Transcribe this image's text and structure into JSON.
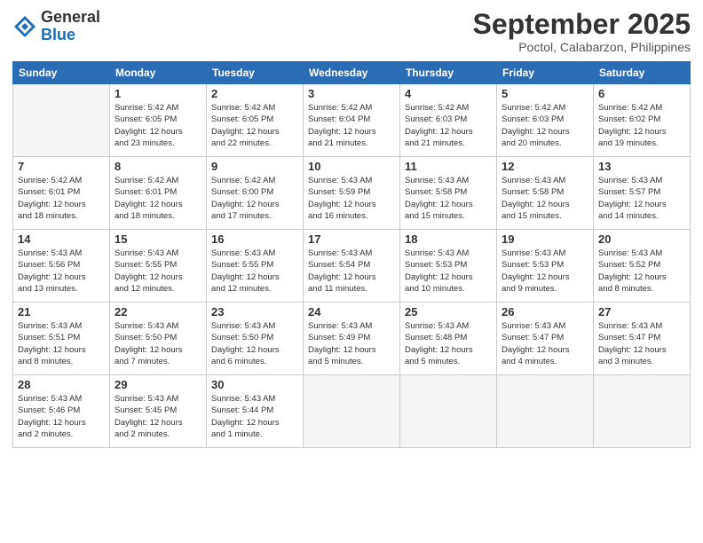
{
  "logo": {
    "general": "General",
    "blue": "Blue"
  },
  "header": {
    "month": "September 2025",
    "location": "Poctol, Calabarzon, Philippines"
  },
  "weekdays": [
    "Sunday",
    "Monday",
    "Tuesday",
    "Wednesday",
    "Thursday",
    "Friday",
    "Saturday"
  ],
  "weeks": [
    [
      {
        "day": "",
        "sunrise": "",
        "sunset": "",
        "daylight": ""
      },
      {
        "day": "1",
        "sunrise": "5:42 AM",
        "sunset": "6:05 PM",
        "dl1": "Daylight: 12 hours",
        "dl2": "and 23 minutes."
      },
      {
        "day": "2",
        "sunrise": "5:42 AM",
        "sunset": "6:05 PM",
        "dl1": "Daylight: 12 hours",
        "dl2": "and 22 minutes."
      },
      {
        "day": "3",
        "sunrise": "5:42 AM",
        "sunset": "6:04 PM",
        "dl1": "Daylight: 12 hours",
        "dl2": "and 21 minutes."
      },
      {
        "day": "4",
        "sunrise": "5:42 AM",
        "sunset": "6:03 PM",
        "dl1": "Daylight: 12 hours",
        "dl2": "and 21 minutes."
      },
      {
        "day": "5",
        "sunrise": "5:42 AM",
        "sunset": "6:03 PM",
        "dl1": "Daylight: 12 hours",
        "dl2": "and 20 minutes."
      },
      {
        "day": "6",
        "sunrise": "5:42 AM",
        "sunset": "6:02 PM",
        "dl1": "Daylight: 12 hours",
        "dl2": "and 19 minutes."
      }
    ],
    [
      {
        "day": "7",
        "sunrise": "5:42 AM",
        "sunset": "6:01 PM",
        "dl1": "Daylight: 12 hours",
        "dl2": "and 18 minutes."
      },
      {
        "day": "8",
        "sunrise": "5:42 AM",
        "sunset": "6:01 PM",
        "dl1": "Daylight: 12 hours",
        "dl2": "and 18 minutes."
      },
      {
        "day": "9",
        "sunrise": "5:42 AM",
        "sunset": "6:00 PM",
        "dl1": "Daylight: 12 hours",
        "dl2": "and 17 minutes."
      },
      {
        "day": "10",
        "sunrise": "5:43 AM",
        "sunset": "5:59 PM",
        "dl1": "Daylight: 12 hours",
        "dl2": "and 16 minutes."
      },
      {
        "day": "11",
        "sunrise": "5:43 AM",
        "sunset": "5:58 PM",
        "dl1": "Daylight: 12 hours",
        "dl2": "and 15 minutes."
      },
      {
        "day": "12",
        "sunrise": "5:43 AM",
        "sunset": "5:58 PM",
        "dl1": "Daylight: 12 hours",
        "dl2": "and 15 minutes."
      },
      {
        "day": "13",
        "sunrise": "5:43 AM",
        "sunset": "5:57 PM",
        "dl1": "Daylight: 12 hours",
        "dl2": "and 14 minutes."
      }
    ],
    [
      {
        "day": "14",
        "sunrise": "5:43 AM",
        "sunset": "5:56 PM",
        "dl1": "Daylight: 12 hours",
        "dl2": "and 13 minutes."
      },
      {
        "day": "15",
        "sunrise": "5:43 AM",
        "sunset": "5:55 PM",
        "dl1": "Daylight: 12 hours",
        "dl2": "and 12 minutes."
      },
      {
        "day": "16",
        "sunrise": "5:43 AM",
        "sunset": "5:55 PM",
        "dl1": "Daylight: 12 hours",
        "dl2": "and 12 minutes."
      },
      {
        "day": "17",
        "sunrise": "5:43 AM",
        "sunset": "5:54 PM",
        "dl1": "Daylight: 12 hours",
        "dl2": "and 11 minutes."
      },
      {
        "day": "18",
        "sunrise": "5:43 AM",
        "sunset": "5:53 PM",
        "dl1": "Daylight: 12 hours",
        "dl2": "and 10 minutes."
      },
      {
        "day": "19",
        "sunrise": "5:43 AM",
        "sunset": "5:53 PM",
        "dl1": "Daylight: 12 hours",
        "dl2": "and 9 minutes."
      },
      {
        "day": "20",
        "sunrise": "5:43 AM",
        "sunset": "5:52 PM",
        "dl1": "Daylight: 12 hours",
        "dl2": "and 8 minutes."
      }
    ],
    [
      {
        "day": "21",
        "sunrise": "5:43 AM",
        "sunset": "5:51 PM",
        "dl1": "Daylight: 12 hours",
        "dl2": "and 8 minutes."
      },
      {
        "day": "22",
        "sunrise": "5:43 AM",
        "sunset": "5:50 PM",
        "dl1": "Daylight: 12 hours",
        "dl2": "and 7 minutes."
      },
      {
        "day": "23",
        "sunrise": "5:43 AM",
        "sunset": "5:50 PM",
        "dl1": "Daylight: 12 hours",
        "dl2": "and 6 minutes."
      },
      {
        "day": "24",
        "sunrise": "5:43 AM",
        "sunset": "5:49 PM",
        "dl1": "Daylight: 12 hours",
        "dl2": "and 5 minutes."
      },
      {
        "day": "25",
        "sunrise": "5:43 AM",
        "sunset": "5:48 PM",
        "dl1": "Daylight: 12 hours",
        "dl2": "and 5 minutes."
      },
      {
        "day": "26",
        "sunrise": "5:43 AM",
        "sunset": "5:47 PM",
        "dl1": "Daylight: 12 hours",
        "dl2": "and 4 minutes."
      },
      {
        "day": "27",
        "sunrise": "5:43 AM",
        "sunset": "5:47 PM",
        "dl1": "Daylight: 12 hours",
        "dl2": "and 3 minutes."
      }
    ],
    [
      {
        "day": "28",
        "sunrise": "5:43 AM",
        "sunset": "5:46 PM",
        "dl1": "Daylight: 12 hours",
        "dl2": "and 2 minutes."
      },
      {
        "day": "29",
        "sunrise": "5:43 AM",
        "sunset": "5:45 PM",
        "dl1": "Daylight: 12 hours",
        "dl2": "and 2 minutes."
      },
      {
        "day": "30",
        "sunrise": "5:43 AM",
        "sunset": "5:44 PM",
        "dl1": "Daylight: 12 hours",
        "dl2": "and 1 minute."
      },
      {
        "day": "",
        "sunrise": "",
        "sunset": "",
        "dl1": "",
        "dl2": ""
      },
      {
        "day": "",
        "sunrise": "",
        "sunset": "",
        "dl1": "",
        "dl2": ""
      },
      {
        "day": "",
        "sunrise": "",
        "sunset": "",
        "dl1": "",
        "dl2": ""
      },
      {
        "day": "",
        "sunrise": "",
        "sunset": "",
        "dl1": "",
        "dl2": ""
      }
    ]
  ]
}
